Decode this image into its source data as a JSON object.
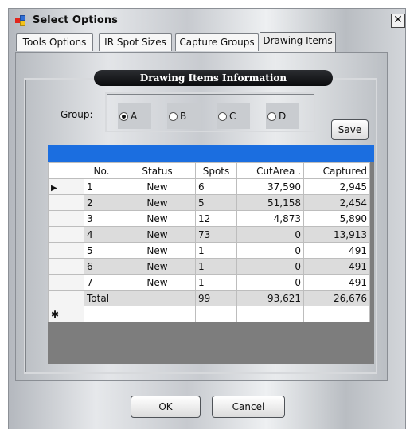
{
  "window": {
    "title": "Select Options",
    "close_label": "✕"
  },
  "tabs": [
    {
      "label": "Tools Options",
      "active": false
    },
    {
      "label": "IR Spot Sizes",
      "active": false
    },
    {
      "label": "Capture Groups",
      "active": false
    },
    {
      "label": "Drawing Items",
      "active": true
    }
  ],
  "panel": {
    "header": "Drawing Items Information",
    "group_label": "Group:",
    "groups": [
      {
        "label": "A",
        "selected": true
      },
      {
        "label": "B",
        "selected": false
      },
      {
        "label": "C",
        "selected": false
      },
      {
        "label": "D",
        "selected": false
      }
    ],
    "save_label": "Save"
  },
  "grid": {
    "columns": [
      "No.",
      "Status",
      "Spots",
      "CutArea .",
      "Captured"
    ],
    "rows": [
      {
        "no": "1",
        "status": "New",
        "spots": "6",
        "cutarea": "37,590",
        "captured": "2,945",
        "marker": "▶"
      },
      {
        "no": "2",
        "status": "New",
        "spots": "5",
        "cutarea": "51,158",
        "captured": "2,454",
        "marker": ""
      },
      {
        "no": "3",
        "status": "New",
        "spots": "12",
        "cutarea": "4,873",
        "captured": "5,890",
        "marker": ""
      },
      {
        "no": "4",
        "status": "New",
        "spots": "73",
        "cutarea": "0",
        "captured": "13,913",
        "marker": ""
      },
      {
        "no": "5",
        "status": "New",
        "spots": "1",
        "cutarea": "0",
        "captured": "491",
        "marker": ""
      },
      {
        "no": "6",
        "status": "New",
        "spots": "1",
        "cutarea": "0",
        "captured": "491",
        "marker": ""
      },
      {
        "no": "7",
        "status": "New",
        "spots": "1",
        "cutarea": "0",
        "captured": "491",
        "marker": ""
      }
    ],
    "total": {
      "label": "Total",
      "status": "",
      "spots": "99",
      "cutarea": "93,621",
      "captured": "26,676"
    },
    "new_row_marker": "✱"
  },
  "footer": {
    "ok_label": "OK",
    "cancel_label": "Cancel"
  },
  "colors": {
    "accent_bar": "#1b6ee0",
    "header_pill": "#111111"
  }
}
